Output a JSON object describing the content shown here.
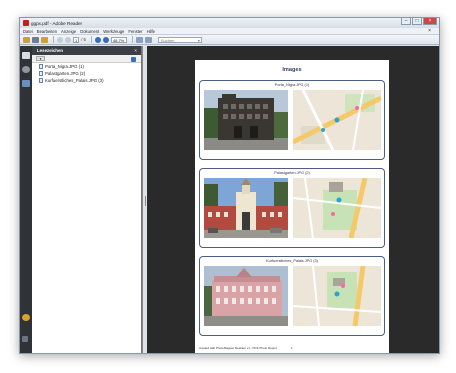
{
  "window": {
    "title": "ggpx.pdf - Adobe Reader"
  },
  "menu": {
    "items": [
      "Datei",
      "Bearbeiten",
      "Anzeige",
      "Dokument",
      "Werkzeuge",
      "Fenster",
      "Hilfe"
    ]
  },
  "toolbar": {
    "page_current": "1",
    "page_total": "/ 5",
    "zoom": "48,7%",
    "search_placeholder": "Suchen"
  },
  "sidebar": {
    "title": "Lesezeichen",
    "bookmarks": [
      {
        "label": "Porta_Nigra.JPG (1)"
      },
      {
        "label": "Palastgarten.JPG (2)"
      },
      {
        "label": "Kurfuerstliches_Palais.JPG (3)"
      }
    ]
  },
  "document": {
    "title": "Images",
    "cards": [
      {
        "label": "Porta_Nigra.JPG (1)"
      },
      {
        "label": "Palastgarten.JPG (2)"
      },
      {
        "label": "Kurfuerstliches_Palais.JPG (3)"
      }
    ],
    "footer": "created with PhotoMapper Desktop v1 - PDF Photo Report",
    "page_number": "1"
  },
  "colors": {
    "accent": "#2e3f66",
    "panel_dark": "#2f3237",
    "doc_bg": "#2a2a2a"
  }
}
